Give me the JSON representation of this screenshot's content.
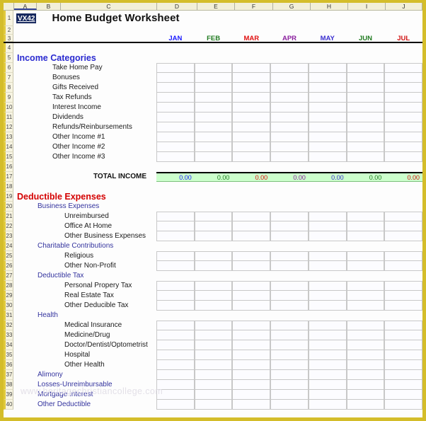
{
  "workbook": {
    "name_box": "VX42",
    "title": "Home Budget Worksheet"
  },
  "columns": [
    "A",
    "B",
    "C",
    "D",
    "E",
    "F",
    "G",
    "H",
    "I",
    "J"
  ],
  "active_column": "A",
  "months": [
    {
      "label": "JAN",
      "color": "#1a1aff"
    },
    {
      "label": "FEB",
      "color": "#1f7a1f"
    },
    {
      "label": "MAR",
      "color": "#e01010"
    },
    {
      "label": "APR",
      "color": "#8a1f9e"
    },
    {
      "label": "MAY",
      "color": "#3a2fd0"
    },
    {
      "label": "JUN",
      "color": "#1f7a1f"
    },
    {
      "label": "JUL",
      "color": "#d01010"
    }
  ],
  "sections": {
    "income": {
      "heading": "Income Categories",
      "heading_color": "#2a2ad0",
      "items": [
        "Take Home Pay",
        "Bonuses",
        "Gifts Received",
        "Tax Refunds",
        "Interest Income",
        "Dividends",
        "Refunds/Reinbursements",
        "Other Income #1",
        "Other Income #2",
        "Other Income #3"
      ],
      "total_label": "TOTAL INCOME",
      "total_values": [
        "0.00",
        "0.00",
        "0.00",
        "0.00",
        "0.00",
        "0.00",
        "0.00"
      ],
      "total_fill": "#ccffcc"
    },
    "expenses": {
      "heading": "Deductible Expenses",
      "heading_color": "#d40000",
      "groups": [
        {
          "name": "Business Expenses",
          "items": [
            "Unreimbursed",
            "Office At Home",
            "Other Business Expenses"
          ]
        },
        {
          "name": "Charitable Contributions",
          "items": [
            "Religious",
            "Other Non-Profit"
          ]
        },
        {
          "name": "Deductible Tax",
          "items": [
            "Personal Propery Tax",
            "Real Estate Tax",
            "Other Deducible Tax"
          ]
        },
        {
          "name": "Health",
          "items": [
            "Medical Insurance",
            "Medicine/Drug",
            "Doctor/Dentist/Optometrist",
            "Hospital",
            "Other Health"
          ]
        },
        {
          "name": "Alimony",
          "items": []
        },
        {
          "name": "Losses-Unreimbursable",
          "items": []
        },
        {
          "name": "Mortgage Interest",
          "items": []
        },
        {
          "name": "Other Deductible",
          "items": []
        }
      ]
    }
  },
  "rows": [
    {
      "n": "1",
      "kind": "title"
    },
    {
      "n": "2",
      "kind": "blank"
    },
    {
      "n": "3",
      "kind": "months"
    },
    {
      "n": "4",
      "kind": "blank"
    },
    {
      "n": "5",
      "kind": "section-income"
    },
    {
      "n": "6",
      "kind": "income-item",
      "i": 0,
      "cells": "input-top"
    },
    {
      "n": "7",
      "kind": "income-item",
      "i": 1,
      "cells": "input"
    },
    {
      "n": "8",
      "kind": "income-item",
      "i": 2,
      "cells": "input"
    },
    {
      "n": "9",
      "kind": "income-item",
      "i": 3,
      "cells": "input"
    },
    {
      "n": "10",
      "kind": "income-item",
      "i": 4,
      "cells": "input"
    },
    {
      "n": "11",
      "kind": "income-item",
      "i": 5,
      "cells": "input"
    },
    {
      "n": "12",
      "kind": "income-item",
      "i": 6,
      "cells": "input"
    },
    {
      "n": "13",
      "kind": "income-item",
      "i": 7,
      "cells": "input"
    },
    {
      "n": "14",
      "kind": "income-item",
      "i": 8,
      "cells": "input"
    },
    {
      "n": "15",
      "kind": "income-item",
      "i": 9,
      "cells": "input"
    },
    {
      "n": "16",
      "kind": "blank"
    },
    {
      "n": "17",
      "kind": "total-income"
    },
    {
      "n": "18",
      "kind": "blank"
    },
    {
      "n": "19",
      "kind": "section-expenses"
    },
    {
      "n": "20",
      "kind": "group",
      "g": 0
    },
    {
      "n": "21",
      "kind": "item",
      "g": 0,
      "i": 0,
      "cells": "input-top"
    },
    {
      "n": "22",
      "kind": "item",
      "g": 0,
      "i": 1,
      "cells": "input"
    },
    {
      "n": "23",
      "kind": "item",
      "g": 0,
      "i": 2,
      "cells": "input"
    },
    {
      "n": "24",
      "kind": "group",
      "g": 1
    },
    {
      "n": "25",
      "kind": "item",
      "g": 1,
      "i": 0,
      "cells": "input-top"
    },
    {
      "n": "26",
      "kind": "item",
      "g": 1,
      "i": 1,
      "cells": "input"
    },
    {
      "n": "27",
      "kind": "group",
      "g": 2
    },
    {
      "n": "28",
      "kind": "item",
      "g": 2,
      "i": 0,
      "cells": "input-top"
    },
    {
      "n": "29",
      "kind": "item",
      "g": 2,
      "i": 1,
      "cells": "input"
    },
    {
      "n": "30",
      "kind": "item",
      "g": 2,
      "i": 2,
      "cells": "input"
    },
    {
      "n": "31",
      "kind": "group",
      "g": 3
    },
    {
      "n": "32",
      "kind": "item",
      "g": 3,
      "i": 0,
      "cells": "input-top"
    },
    {
      "n": "33",
      "kind": "item",
      "g": 3,
      "i": 1,
      "cells": "input"
    },
    {
      "n": "34",
      "kind": "item",
      "g": 3,
      "i": 2,
      "cells": "input"
    },
    {
      "n": "35",
      "kind": "item",
      "g": 3,
      "i": 3,
      "cells": "input"
    },
    {
      "n": "36",
      "kind": "item",
      "g": 3,
      "i": 4,
      "cells": "input"
    },
    {
      "n": "37",
      "kind": "group",
      "g": 4,
      "cells": "input"
    },
    {
      "n": "38",
      "kind": "group",
      "g": 5,
      "cells": "input"
    },
    {
      "n": "39",
      "kind": "group",
      "g": 6,
      "cells": "input"
    },
    {
      "n": "40",
      "kind": "group",
      "g": 7,
      "cells": "input"
    }
  ],
  "watermark": "www.heritagechristiancollege.com"
}
